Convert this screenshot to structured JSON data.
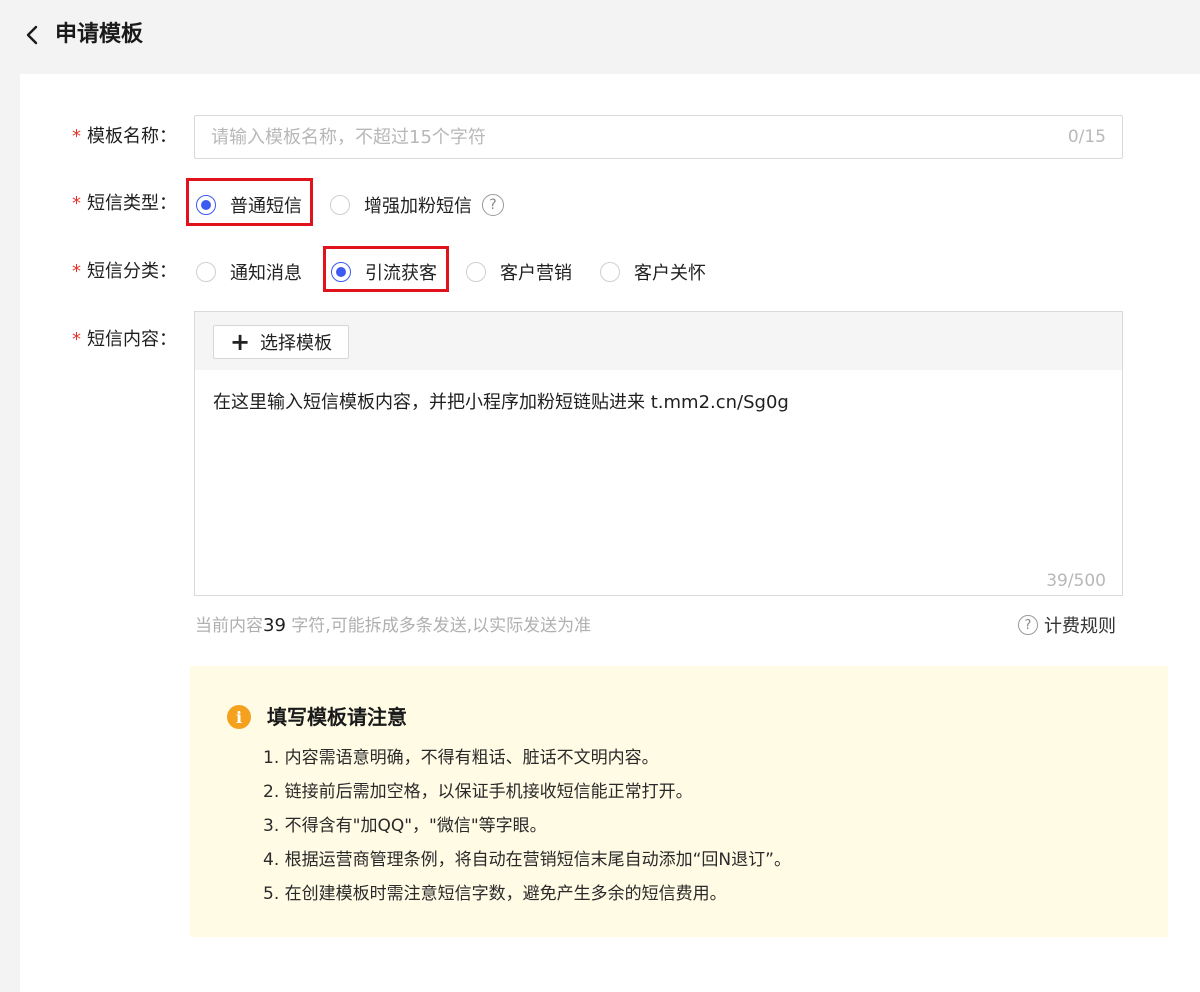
{
  "header": {
    "title": "申请模板"
  },
  "form": {
    "name": {
      "label": "模板名称：",
      "placeholder": "请输入模板名称，不超过15个字符",
      "value": "",
      "count": "0/15"
    },
    "sms_type": {
      "label": "短信类型：",
      "options": [
        {
          "label": "普通短信",
          "checked": true
        },
        {
          "label": "增强加粉短信",
          "checked": false
        }
      ]
    },
    "sms_category": {
      "label": "短信分类：",
      "options": [
        {
          "label": "通知消息",
          "checked": false
        },
        {
          "label": "引流获客",
          "checked": true
        },
        {
          "label": "客户营销",
          "checked": false
        },
        {
          "label": "客户关怀",
          "checked": false
        }
      ]
    },
    "content": {
      "label": "短信内容：",
      "choose_template": "选择模板",
      "value": "在这里输入短信模板内容，并把小程序加粉短链贴进来 t.mm2.cn/Sg0g",
      "count": "39/500"
    },
    "hint": {
      "prefix": "当前内容",
      "count": "39",
      "suffix": " 字符,可能拆成多条发送,以实际发送为准"
    },
    "billing_rules": "计费规则"
  },
  "notice": {
    "title": "填写模板请注意",
    "items": [
      "1. 内容需语意明确，不得有粗话、脏话不文明内容。",
      "2. 链接前后需加空格，以保证手机接收短信能正常打开。",
      "3. 不得含有\"加QQ\"，\"微信\"等字眼。",
      "4. 根据运营商管理条例，将自动在营销短信末尾自动添加“回N退订”。",
      "5. 在创建模板时需注意短信字数，避免产生多余的短信费用。"
    ]
  },
  "colors": {
    "accent": "#3d5af1",
    "required": "#e6332a",
    "highlight": "#e0121b",
    "notice_bg": "#fffbe5",
    "notice_icon": "#f4a11e"
  }
}
